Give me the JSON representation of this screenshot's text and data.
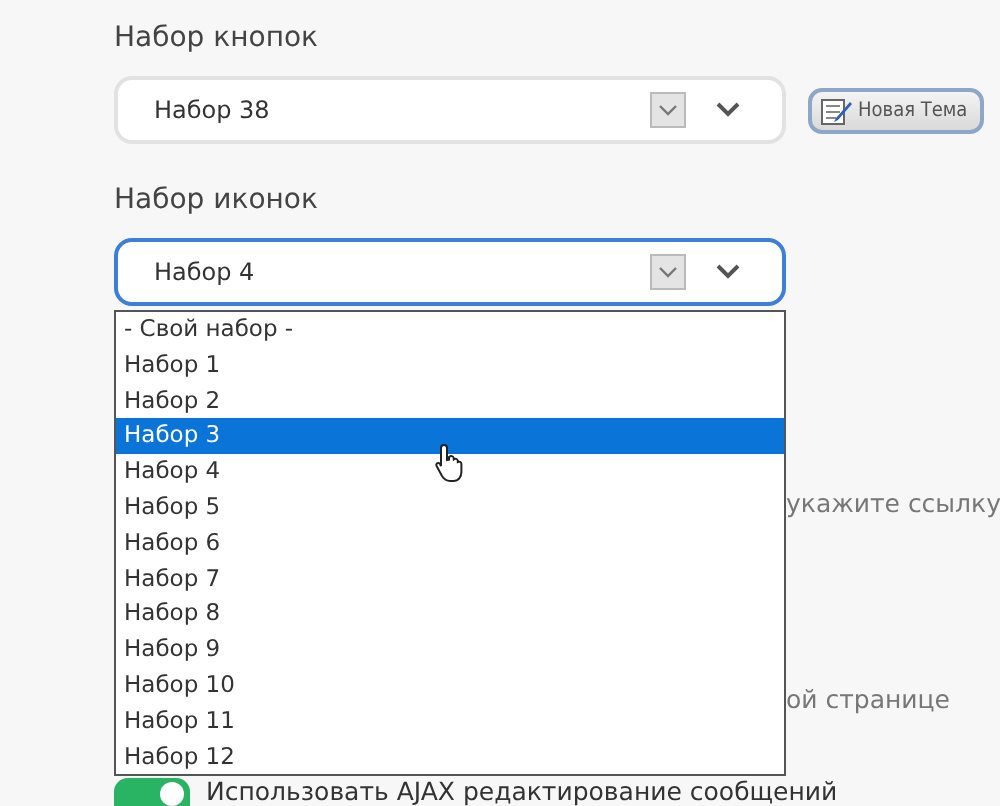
{
  "button_set": {
    "label": "Набор кнопок",
    "value": "Набор 38",
    "new_topic_button": "Новая Тема"
  },
  "icon_set": {
    "label": "Набор иконок",
    "value": "Набор 4",
    "focused": true,
    "options": [
      {
        "label": "- Свой набор -",
        "highlighted": false
      },
      {
        "label": "Набор 1",
        "highlighted": false
      },
      {
        "label": "Набор 2",
        "highlighted": false
      },
      {
        "label": "Набор 3",
        "highlighted": true
      },
      {
        "label": "Набор 4",
        "highlighted": false
      },
      {
        "label": "Набор 5",
        "highlighted": false
      },
      {
        "label": "Набор 6",
        "highlighted": false
      },
      {
        "label": "Набор 7",
        "highlighted": false
      },
      {
        "label": "Набор 8",
        "highlighted": false
      },
      {
        "label": "Набор 9",
        "highlighted": false
      },
      {
        "label": "Набор 10",
        "highlighted": false
      },
      {
        "label": "Набор 11",
        "highlighted": false
      },
      {
        "label": "Набор 12",
        "highlighted": false
      }
    ]
  },
  "background_texts": [
    "укажите ссылку",
    "ой странице"
  ],
  "ajax_edit": {
    "label": "Использовать AJAX редактирование сообщений",
    "on": true
  }
}
